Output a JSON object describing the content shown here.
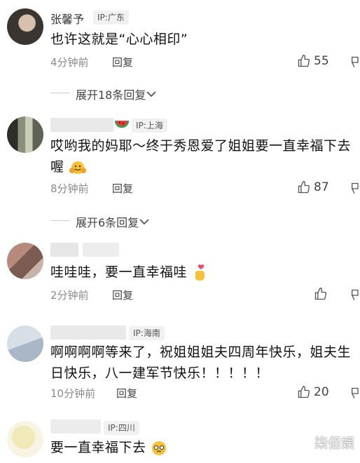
{
  "comments": [
    {
      "username": "张馨予",
      "ip": "IP:广东",
      "text": "也许这就是“心心相印”",
      "time": "4分钟前",
      "reply": "回复",
      "likes": "55",
      "expand": "展开18条回复"
    },
    {
      "username": "",
      "ip": "IP:上海",
      "text_line1": "哎哟我的妈耶～终于秀恩爱了姐姐要一直幸福下去",
      "text_line2": "喔",
      "time": "8分钟前",
      "reply": "回复",
      "likes": "87",
      "expand": "展开6条回复"
    },
    {
      "username": "",
      "text": "哇哇哇，要一直幸福哇",
      "time": "2分钟前",
      "reply": "回复",
      "likes": ""
    },
    {
      "username": "",
      "ip": "IP:海南",
      "text_line1": "啊啊啊啊等来了，祝姐姐姐夫四周年快乐，姐夫生",
      "text_line2": "日快乐，八一建军节快乐！！！！！",
      "time": "10分钟前",
      "reply": "回复",
      "likes": "20"
    },
    {
      "username": "",
      "ip": "IP:四川",
      "text": "要一直幸福下去"
    }
  ],
  "watermark": "柒佰娱",
  "icons": {
    "like": "thumbs-up-icon",
    "dislike": "thumbs-down-icon",
    "expand": "chevron-down-icon",
    "emoji_hug": "hug-face-emoji-icon",
    "emoji_finger_heart": "finger-heart-emoji-icon",
    "emoji_watermelon": "watermelon-icon",
    "emoji_pleading": "pleading-face-emoji-icon"
  }
}
